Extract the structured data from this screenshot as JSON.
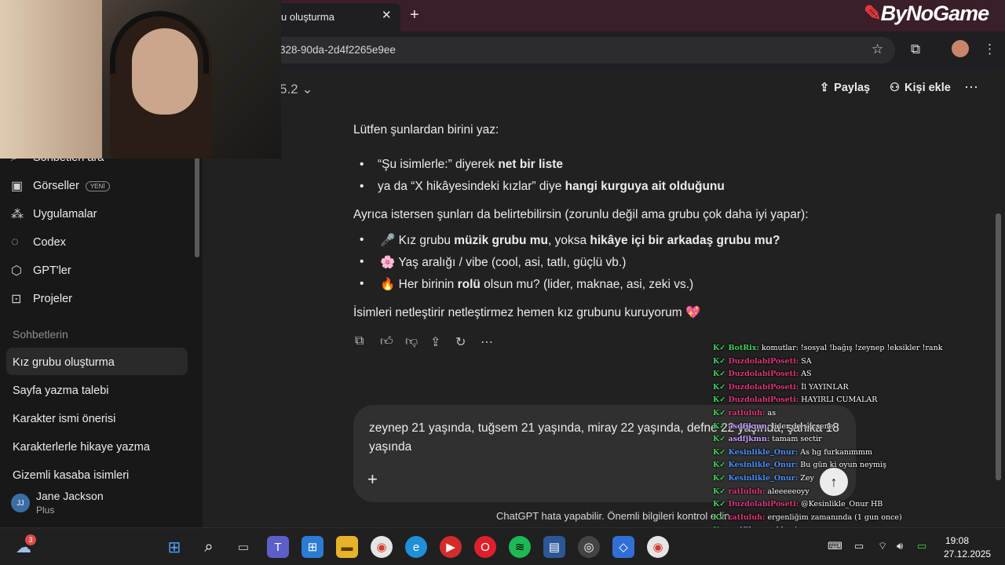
{
  "browser": {
    "tab_title": "Kız grubu oluşturma",
    "tab_title_visible": "u oluşturma",
    "url_visible": "328-90da-2d4f2265e9ee",
    "logo_text": "ByNoGame"
  },
  "sidebar": {
    "items": [
      {
        "label": "Sohbetleri ara",
        "icon": "search-icon"
      },
      {
        "label": "Görseller",
        "icon": "image-icon",
        "badge": "YENİ"
      },
      {
        "label": "Uygulamalar",
        "icon": "apps-icon"
      },
      {
        "label": "Codex",
        "icon": "codex-icon"
      },
      {
        "label": "GPT'ler",
        "icon": "cube-icon"
      },
      {
        "label": "Projeler",
        "icon": "folder-icon"
      }
    ],
    "chats_heading": "Sohbetlerin",
    "chats": [
      "Kız grubu oluşturma",
      "Sayfa yazma talebi",
      "Karakter ismi önerisi",
      "Karakterlerle hikaye yazma",
      "Gizemli kasaba isimleri"
    ],
    "user": {
      "initials": "JJ",
      "name": "Jane Jackson",
      "plan": "Plus"
    }
  },
  "header": {
    "model": "5.2",
    "share": "Paylaş",
    "add_person": "Kişi ekle"
  },
  "message": {
    "intro": "Lütfen şunlardan birini yaz:",
    "b1_pre": "“Şu isimlerle:” diyerek ",
    "b1_bold": "net bir liste",
    "b2_pre": "ya da “X hikâyesindeki kızlar” diye ",
    "b2_bold": "hangi kurguya ait olduğunu",
    "optional": "Ayrıca istersen şunları da belirtebilirsin (zorunlu değil ama grubu çok daha iyi yapar):",
    "o1_emoji": "🎤",
    "o1_pre": " Kız grubu ",
    "o1_bold1": "müzik grubu mu",
    "o1_mid": ", yoksa ",
    "o1_bold2": "hikâye içi bir arkadaş grubu mu?",
    "o2_emoji": "🌸",
    "o2_text": " Yaş aralığı / vibe (cool, asi, tatlı, güçlü vb.)",
    "o3_emoji": "🔥",
    "o3_pre": " Her birinin ",
    "o3_bold": "rolü",
    "o3_post": " olsun mu? (lider, maknae, asi, zeki vs.)",
    "closing": "İsimleri netleştirir netleştirmez hemen kız grubunu kuruyorum 💖"
  },
  "composer": {
    "text": "zeynep 21 yaşında, tuğsem 21 yaşında, miray 22 yaşında, defne 22 yaşında, şahika 18 yaşında"
  },
  "disclaimer": "ChatGPT hata yapabilir. Önemli bilgileri kontrol edin.",
  "stream_chat": [
    {
      "user": "BotRix:",
      "color": "#3fd45a",
      "text": "komutlar: !sosyal !bağış !zeynep !eksikler !rank"
    },
    {
      "user": "DuzdolabiPoseti:",
      "color": "#e0357a",
      "text": "SA"
    },
    {
      "user": "DuzdolabiPoseti:",
      "color": "#e0357a",
      "text": "AS"
    },
    {
      "user": "DuzdolabiPoseti:",
      "color": "#e0357a",
      "text": "İl YAYINLAR"
    },
    {
      "user": "DuzdolabiPoseti:",
      "color": "#e0357a",
      "text": "HAYIRLI CUMALAR"
    },
    {
      "user": "ratluluh:",
      "color": "#e0357a",
      "text": "as"
    },
    {
      "user": "asdfjkmn:",
      "color": "#c7a0ff",
      "text": "lider de secsene"
    },
    {
      "user": "asdfjkmn:",
      "color": "#c7a0ff",
      "text": "tamam sectir"
    },
    {
      "user": "Kesinlikle_Onur:",
      "color": "#4a90ff",
      "text": "As hg furkanımmm"
    },
    {
      "user": "Kesinlikle_Onur:",
      "color": "#4a90ff",
      "text": "Bu gün ki oyun neymiş"
    },
    {
      "user": "Kesinlikle_Onur:",
      "color": "#4a90ff",
      "text": "Zey"
    },
    {
      "user": "ratluluh:",
      "color": "#e0357a",
      "text": "aleeeeeoyy"
    },
    {
      "user": "DuzdolabiPoseti:",
      "color": "#e0357a",
      "text": "@Kesinlikle_Onur HB"
    },
    {
      "user": "ratluluh:",
      "color": "#e0357a",
      "text": "ergenliğim zamanında (1 gun once)"
    },
    {
      "user": "asdfjkmn:",
      "color": "#c7a0ff",
      "text": "eklemi"
    },
    {
      "user": "asdfjkmn:",
      "color": "#c7a0ff",
      "text": "kiz kiza olan bir sey"
    }
  ],
  "taskbar": {
    "weather_badge": "3",
    "time": "19:08",
    "date": "27.12.2025"
  }
}
